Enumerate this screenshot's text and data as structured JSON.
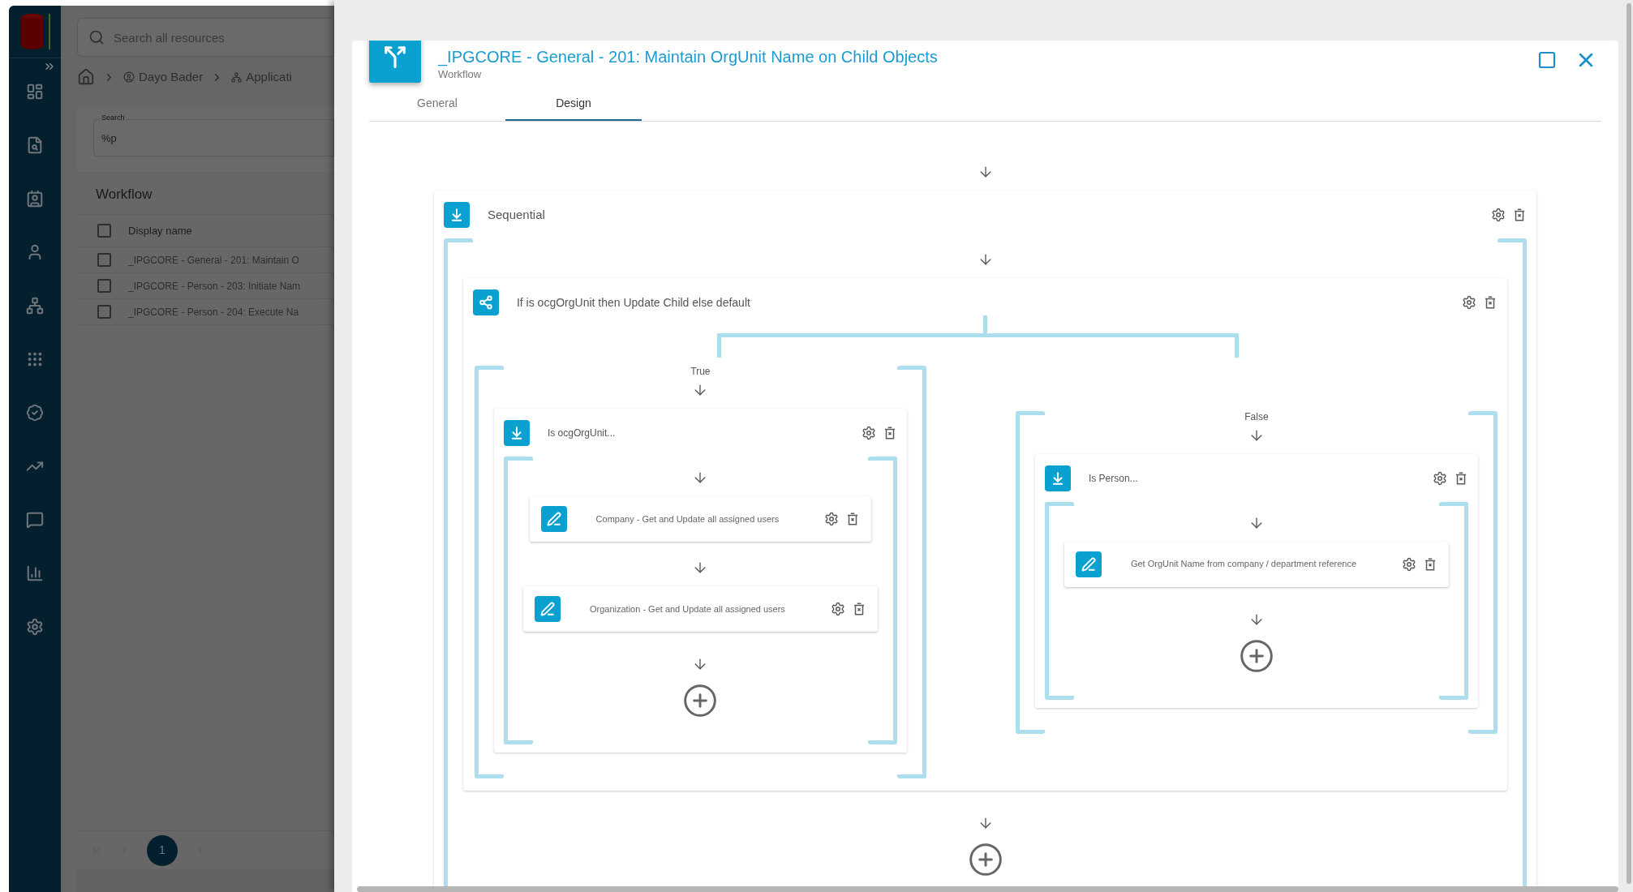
{
  "app": {
    "search": {
      "placeholder": "Search all resources"
    },
    "breadcrumb": [
      {
        "kind": "home"
      },
      {
        "kind": "person",
        "label": "Dayo Bader"
      },
      {
        "kind": "application",
        "label": "Applicati"
      }
    ],
    "filter": {
      "label": "Search",
      "value": "%p"
    },
    "table": {
      "title": "Workflow",
      "select_all": {
        "checked": false
      },
      "columns": [
        "Display name"
      ],
      "rows": [
        {
          "display_name": "_IPGCORE - General - 201: Maintain O",
          "checked": false
        },
        {
          "display_name": "_IPGCORE - Person - 203: Initiate Nam",
          "checked": false
        },
        {
          "display_name": "_IPGCORE - Person - 204: Execute Na",
          "checked": false
        }
      ]
    },
    "pagination": {
      "pages": [
        {
          "label": "1",
          "selected": true
        }
      ]
    }
  },
  "dialog": {
    "title": "_IPGCORE - General - 201: Maintain OrgUnit Name on Child Objects",
    "subtitle": "Workflow",
    "tabs": [
      {
        "label": "General",
        "selected": false
      },
      {
        "label": "Design",
        "selected": true
      }
    ],
    "designer": {
      "kind": "sequence",
      "label": "Sequential",
      "children": [
        {
          "kind": "branch",
          "label": "If is ocgOrgUnit then Update Child else default",
          "branches": [
            {
              "label": "True",
              "node": {
                "kind": "sequence",
                "label": "Is ocgOrgUnit...",
                "children": [
                  {
                    "kind": "activity",
                    "label": "Company - Get and Update all assigned users"
                  },
                  {
                    "kind": "activity",
                    "label": "Organization - Get and Update all assigned users"
                  }
                ]
              }
            },
            {
              "label": "False",
              "node": {
                "kind": "sequence",
                "label": "Is Person...",
                "children": [
                  {
                    "kind": "activity",
                    "label": "Get OrgUnit Name from company / department reference"
                  }
                ]
              }
            }
          ]
        }
      ]
    }
  }
}
